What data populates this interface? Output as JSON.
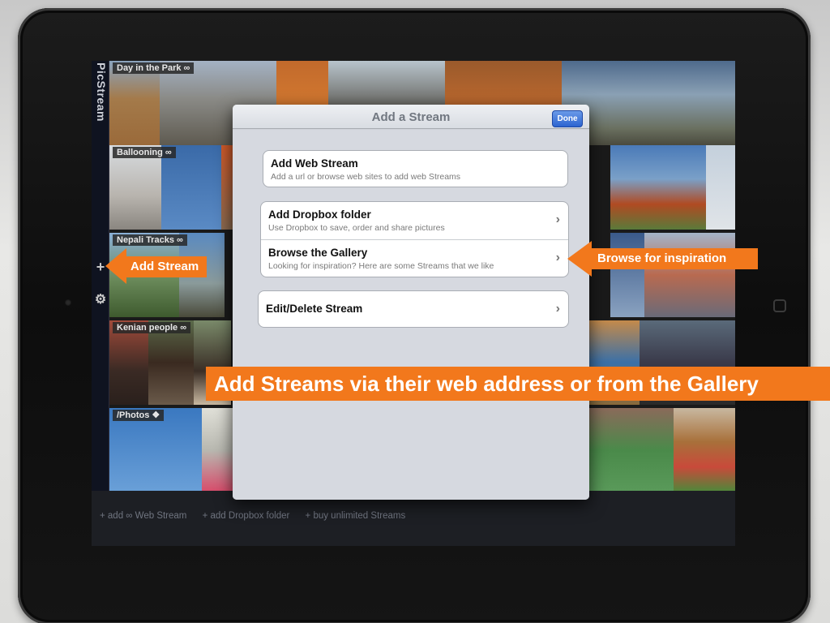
{
  "app": {
    "logo_text": "PicStream",
    "sidebar_icons": [
      "plus-icon",
      "gear-icon"
    ]
  },
  "streams": [
    {
      "label": "Day in the Park ∞"
    },
    {
      "label": "Ballooning ∞"
    },
    {
      "label": "Nepali Tracks ∞"
    },
    {
      "label": "Kenian people ∞"
    },
    {
      "label": "/Photos"
    }
  ],
  "bottom_bar": {
    "links": [
      "+ add ∞ Web Stream",
      "+ add Dropbox folder",
      "+ buy unlimited Streams"
    ]
  },
  "modal": {
    "title": "Add a Stream",
    "done_label": "Done",
    "add_web": {
      "title": "Add Web Stream",
      "subtitle": "Add a url or browse web sites to add web Streams"
    },
    "add_dropbox": {
      "title": "Add Dropbox folder",
      "subtitle": "Use Dropbox to save, order and share pictures"
    },
    "browse_gallery": {
      "title": "Browse the Gallery",
      "subtitle": "Looking for inspiration? Here are some Streams that we like"
    },
    "edit_delete": {
      "title": "Edit/Delete Stream"
    }
  },
  "annotations": {
    "add_stream": "Add Stream",
    "browse_inspiration": "Browse for inspiration",
    "banner": "Add Streams via their web address or from the Gallery"
  },
  "colors": {
    "accent_orange": "#f2781c",
    "done_blue": "#2c64d0"
  }
}
